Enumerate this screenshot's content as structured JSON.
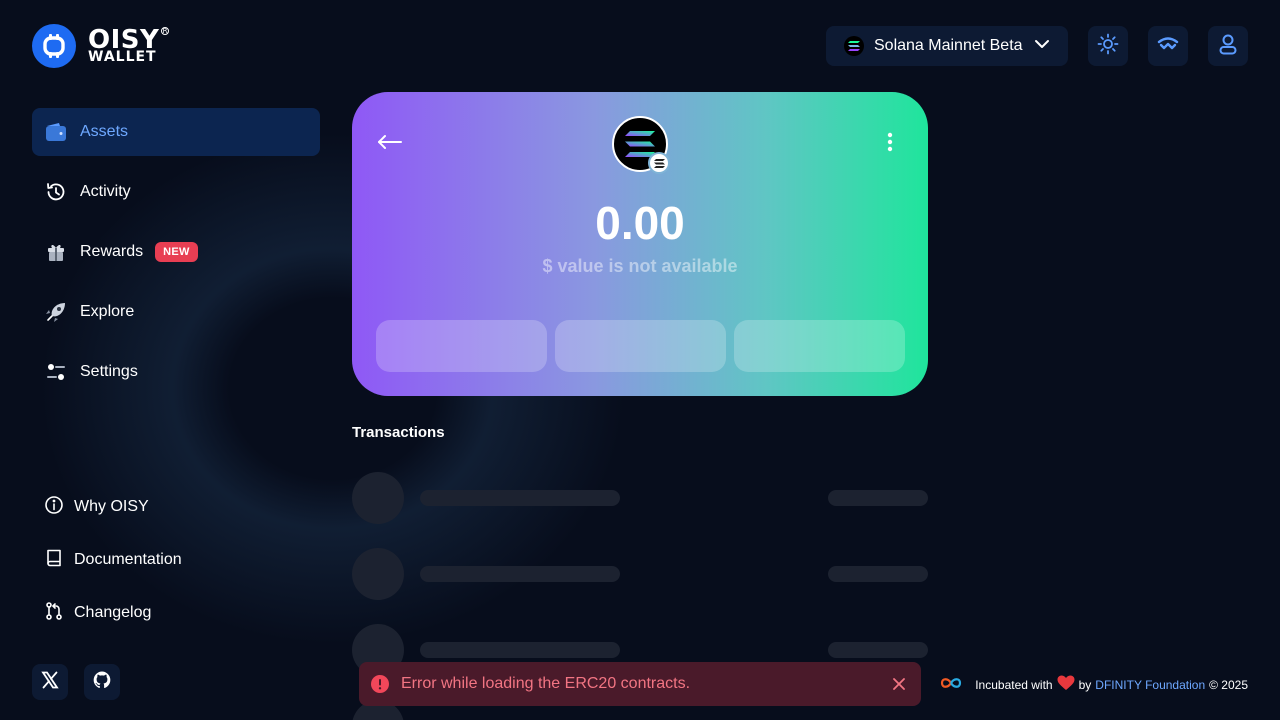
{
  "brand": {
    "line1": "OISY",
    "line2": "WALLET"
  },
  "header": {
    "network_label": "Solana Mainnet Beta"
  },
  "sidebar": {
    "items": [
      {
        "label": "Assets"
      },
      {
        "label": "Activity"
      },
      {
        "label": "Rewards",
        "badge": "NEW"
      },
      {
        "label": "Explore"
      },
      {
        "label": "Settings"
      }
    ],
    "links": [
      {
        "label": "Why OISY"
      },
      {
        "label": "Documentation"
      },
      {
        "label": "Changelog"
      }
    ]
  },
  "token_card": {
    "balance": "0.00",
    "usd_note": "$ value is not available"
  },
  "transactions": {
    "title": "Transactions"
  },
  "toast": {
    "message": "Error while loading the ERC20 contracts."
  },
  "footer": {
    "incubated": "Incubated with",
    "by": "by",
    "org": "DFINITY Foundation",
    "copyright": "© 2025"
  },
  "colors": {
    "background": "#070d1c",
    "accent": "#1e6bf2",
    "active_label": "#6ea8ff",
    "badge": "#e83e53",
    "error": "#f27583"
  }
}
